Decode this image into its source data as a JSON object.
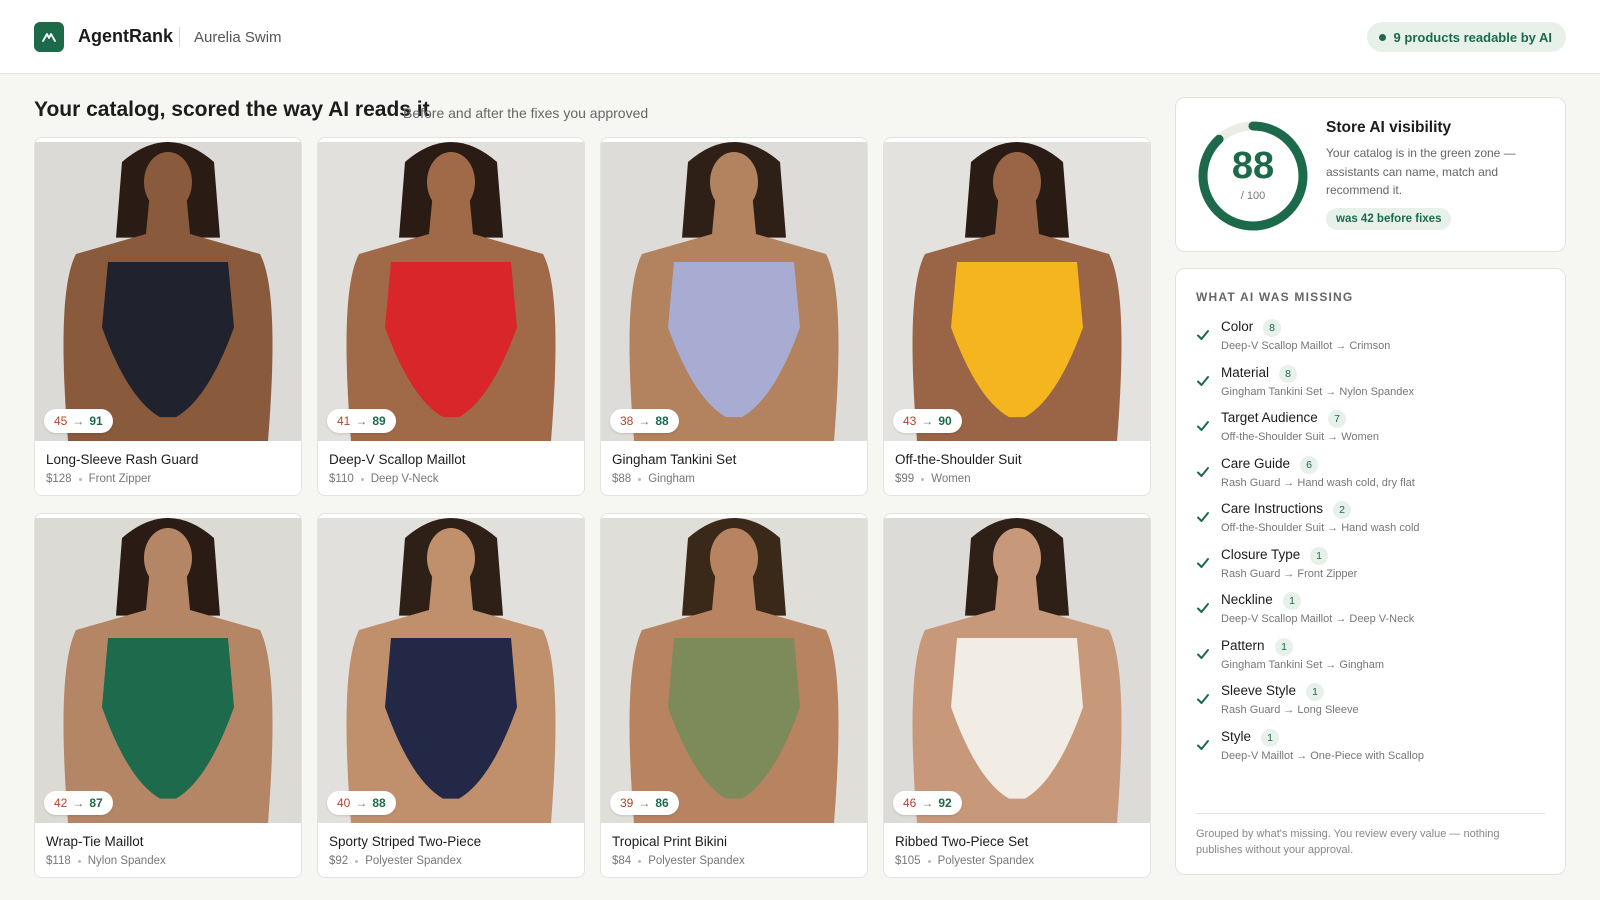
{
  "header": {
    "brand": "AgentRank",
    "store_name": "Aurelia Swim",
    "readable_status": "9 products readable by AI"
  },
  "page": {
    "title": "Your catalog, scored the way AI reads it",
    "subtitle": "Before and after the fixes you approved"
  },
  "products": [
    {
      "name": "Long-Sleeve Rash Guard",
      "price": "$128",
      "attribute": "Front Zipper",
      "score_before": "45",
      "score_after": "91",
      "swatch": "#20232e",
      "backdrop": "#dcdad6",
      "skin": "#8a5a3c",
      "hair": "#2a1c14"
    },
    {
      "name": "Deep-V Scallop Maillot",
      "price": "$110",
      "attribute": "Deep V-Neck",
      "score_before": "41",
      "score_after": "89",
      "swatch": "#d9262a",
      "backdrop": "#e2e0dc",
      "skin": "#a06a48",
      "hair": "#2a1c14"
    },
    {
      "name": "Gingham Tankini Set",
      "price": "$88",
      "attribute": "Gingham",
      "score_before": "38",
      "score_after": "88",
      "swatch": "#a9acd2",
      "backdrop": "#dedcd8",
      "skin": "#b3825e",
      "hair": "#2e2016"
    },
    {
      "name": "Off-the-Shoulder Suit",
      "price": "$99",
      "attribute": "Women",
      "score_before": "43",
      "score_after": "90",
      "swatch": "#f4b51e",
      "backdrop": "#e4e2de",
      "skin": "#9a6546",
      "hair": "#2a1c14"
    },
    {
      "name": "Wrap-Tie Maillot",
      "price": "$118",
      "attribute": "Nylon Spandex",
      "score_before": "42",
      "score_after": "87",
      "swatch": "#1d6b4c",
      "backdrop": "#dcdad5",
      "skin": "#b58666",
      "hair": "#2a1c14"
    },
    {
      "name": "Sporty Striped Two-Piece",
      "price": "$92",
      "attribute": "Polyester Spandex",
      "score_before": "40",
      "score_after": "88",
      "swatch": "#232846",
      "backdrop": "#e2e0dc",
      "skin": "#c0906c",
      "hair": "#2e2016"
    },
    {
      "name": "Tropical Print Bikini",
      "price": "$84",
      "attribute": "Polyester Spandex",
      "score_before": "39",
      "score_after": "86",
      "swatch": "#7d8a5a",
      "backdrop": "#e0ded9",
      "skin": "#b88360",
      "hair": "#3a2818"
    },
    {
      "name": "Ribbed Two-Piece Set",
      "price": "$105",
      "attribute": "Polyester Spandex",
      "score_before": "46",
      "score_after": "92",
      "swatch": "#f1ece4",
      "backdrop": "#dddbd7",
      "skin": "#c8987a",
      "hair": "#2e2016"
    }
  ],
  "visibility": {
    "title": "Store AI visibility",
    "score": "88",
    "score_value": 88,
    "score_max": "/ 100",
    "description": "Your catalog is in the green zone — assistants can name, match and recommend it.",
    "previous": "was 42 before fixes"
  },
  "missing": {
    "title": "WHAT AI WAS MISSING",
    "items": [
      {
        "name": "Color",
        "count": "8",
        "detail": "Deep-V Scallop Maillot → Crimson"
      },
      {
        "name": "Material",
        "count": "8",
        "detail": "Gingham Tankini Set → Nylon Spandex"
      },
      {
        "name": "Target Audience",
        "count": "7",
        "detail": "Off-the-Shoulder Suit → Women"
      },
      {
        "name": "Care Guide",
        "count": "6",
        "detail": "Rash Guard → Hand wash cold, dry flat"
      },
      {
        "name": "Care Instructions",
        "count": "2",
        "detail": "Off-the-Shoulder Suit → Hand wash cold"
      },
      {
        "name": "Closure Type",
        "count": "1",
        "detail": "Rash Guard → Front Zipper"
      },
      {
        "name": "Neckline",
        "count": "1",
        "detail": "Deep-V Scallop Maillot → Deep V-Neck"
      },
      {
        "name": "Pattern",
        "count": "1",
        "detail": "Gingham Tankini Set → Gingham"
      },
      {
        "name": "Sleeve Style",
        "count": "1",
        "detail": "Rash Guard → Long Sleeve"
      },
      {
        "name": "Style",
        "count": "1",
        "detail": "Deep-V Maillot → One-Piece with Scallop"
      }
    ],
    "footnote": "Grouped by what's missing. You review every value — nothing publishes without your approval."
  },
  "colors": {
    "accent": "#1c6a4a",
    "accent_soft": "#e7f1ea",
    "before_score": "#b2452a"
  }
}
